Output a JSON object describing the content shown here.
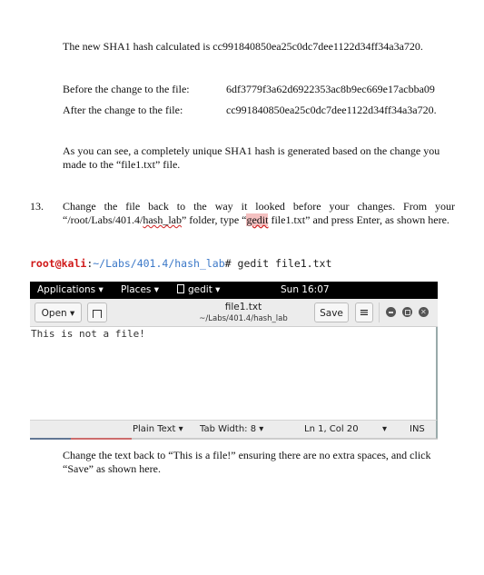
{
  "document": {
    "sha1_sentence_prefix": "The new SHA1 hash calculated is ",
    "sha1_new": "cc991840850ea25c0dc7dee1122d34ff34a3a720.",
    "before_label": "Before the change to the file:",
    "before_hash": "6df3779f3a62d6922353ac8b9ec669e17acbba09",
    "after_label": "After the change to the file:",
    "after_hash": "cc991840850ea25c0dc7dee1122d34ff34a3a720.",
    "explanation": "As you can see, a completely unique SHA1 hash is generated based on the change you made to the “file1.txt” file.",
    "step_number": "13.",
    "step_line1": "Change the file back to the way it looked before your changes. From your",
    "step_line2_a": "“/root/Labs/401.4/",
    "step_line2_b": "hash_lab",
    "step_line2_c": "” folder, type “",
    "step_line2_d": "gedit",
    "step_line2_e": " file1.txt” and press Enter, as shown here.",
    "final_instruction": "Change the text back to “This is a file!” ensuring there are no extra spaces, and click “Save” as shown here."
  },
  "terminal": {
    "user_host": "root@kali",
    "sep": ":",
    "path": "~/Labs/401.4/hash_lab",
    "prompt": "# ",
    "command": "gedit file1.txt"
  },
  "gnome_topbar": {
    "applications": "Applications ▾",
    "places": "Places ▾",
    "app_menu": "gedit ▾",
    "clock": "Sun 16:07"
  },
  "gedit": {
    "open_label": "Open ▾",
    "new_tab_icon": "new-tab-icon",
    "title": "file1.txt",
    "subtitle": "~/Labs/401.4/hash_lab",
    "save_label": "Save",
    "menu_icon": "≡",
    "content": "This is not a file!",
    "status": {
      "language": "Plain Text ▾",
      "tab_width": "Tab Width: 8 ▾",
      "position": "Ln 1, Col 20",
      "dropdown": "▾",
      "mode": "INS"
    }
  }
}
